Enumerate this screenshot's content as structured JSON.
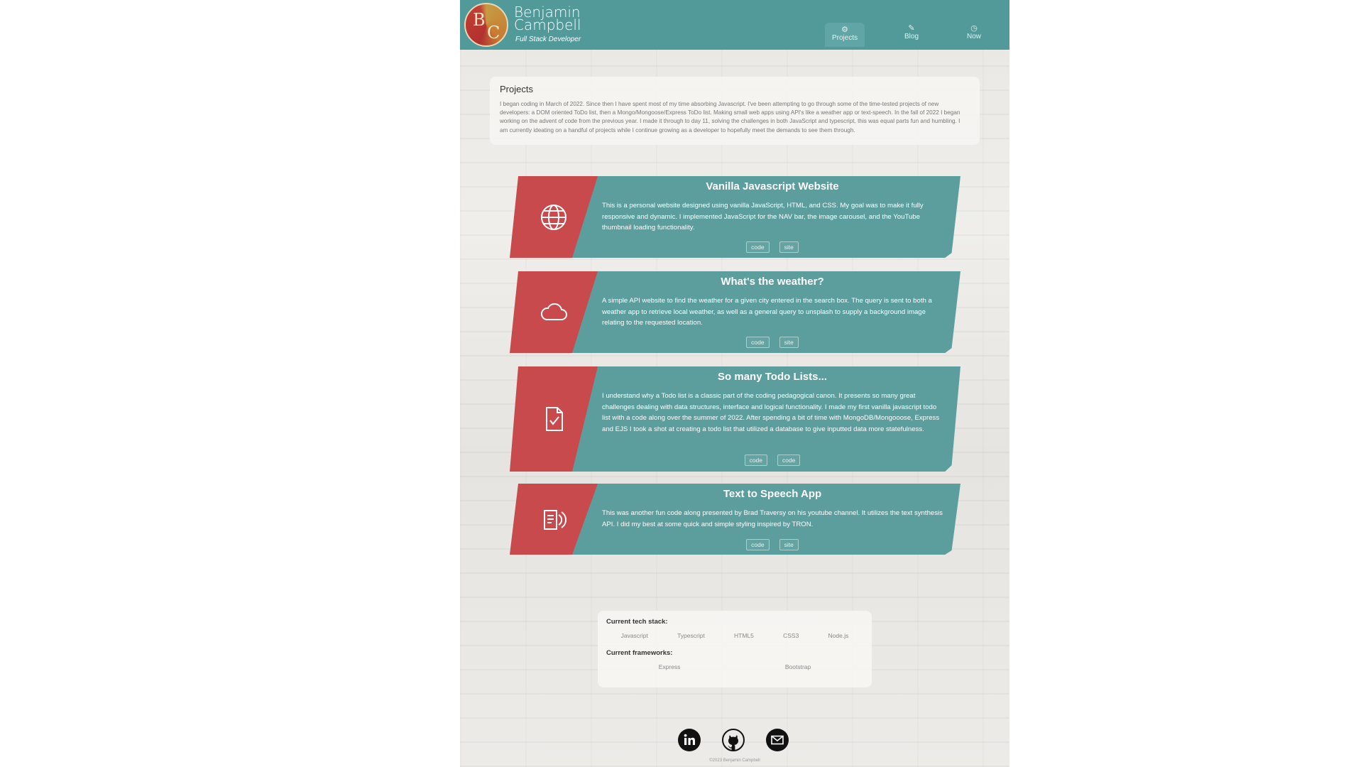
{
  "header": {
    "brand_name": "Benjamin Campbell",
    "brand_sub": "Full Stack Developer",
    "logo_letters": [
      "B",
      "C"
    ],
    "nav": [
      {
        "label": "Projects",
        "icon": "gear-icon",
        "active": true
      },
      {
        "label": "Blog",
        "icon": "pencil-icon",
        "active": false
      },
      {
        "label": "Now",
        "icon": "clock-icon",
        "active": false
      }
    ]
  },
  "intro": {
    "title": "Projects",
    "text": "I began coding in March of 2022. Since then I have spent most of my time absorbing Javascript. I've been attempting to go through some of the time-tested projects of new developers: a DOM oriented ToDo list, then a Mongo/Mongoose/Express ToDo list. Making small web apps using API's like a weather app or text-speech. In the fall of 2022 I began working on the advent of code from the previous year. I made it through to day 11, solving the challenges in both JavaScript and typescript, this was equal parts fun and humbling. I am currently ideating on a handful of projects while I continue growing as a developer to hopefully meet the demands to see them through."
  },
  "projects": [
    {
      "title": "Vanilla Javascript Website",
      "icon": "globe-icon",
      "description": "This is a personal website designed using vanilla JavaScript, HTML, and CSS. My goal was to make it fully responsive and dynamic. I implemented JavaScript for the NAV bar, the image carousel, and the YouTube thumbnail loading functionality.",
      "links": [
        "code",
        "site"
      ]
    },
    {
      "title": "What's the weather?",
      "icon": "cloud-icon",
      "description": "A simple API website to find the weather for a given city entered in the search box. The query is sent to both a weather app to retrieve local weather, as well as a general query to unsplash to supply a background image relating to the requested location.",
      "links": [
        "code",
        "site"
      ]
    },
    {
      "title": "So many Todo Lists...",
      "icon": "document-check-icon",
      "description": "I understand why a Todo list is a classic part of the coding pedagogical canon. It presents so many great challenges dealing with data structures, interface and logical functionality. I made my first vanilla javascript todo list with a code along over the summer of 2022. After spending a bit of time with MongoDB/Mongooose, Express and EJS I took a shot at creating a todo list that utilized a database to give inputted data more statefulness.",
      "links": [
        "code",
        "code"
      ]
    },
    {
      "title": "Text to Speech App",
      "icon": "speech-document-icon",
      "description": "This was another fun code along presented by Brad Traversy on his youtube channel. It utilizes the text synthesis API. I did my best at some quick and simple styling inspired by TRON.",
      "links": [
        "code",
        "site"
      ]
    }
  ],
  "stack": {
    "tech_label": "Current tech stack:",
    "tech": [
      "Javascript",
      "Typescript",
      "HTML5",
      "CSS3",
      "Node.js"
    ],
    "frameworks_label": "Current frameworks:",
    "frameworks": [
      "Express",
      "Bootstrap"
    ]
  },
  "footer": {
    "social": [
      "linkedin-icon",
      "github-icon",
      "mail-icon"
    ],
    "copyright": "©2023 Benjamin Campbell"
  },
  "colors": {
    "header": "#52999a",
    "card_teal": "#5c9d9d",
    "card_red": "#c94a4d"
  }
}
